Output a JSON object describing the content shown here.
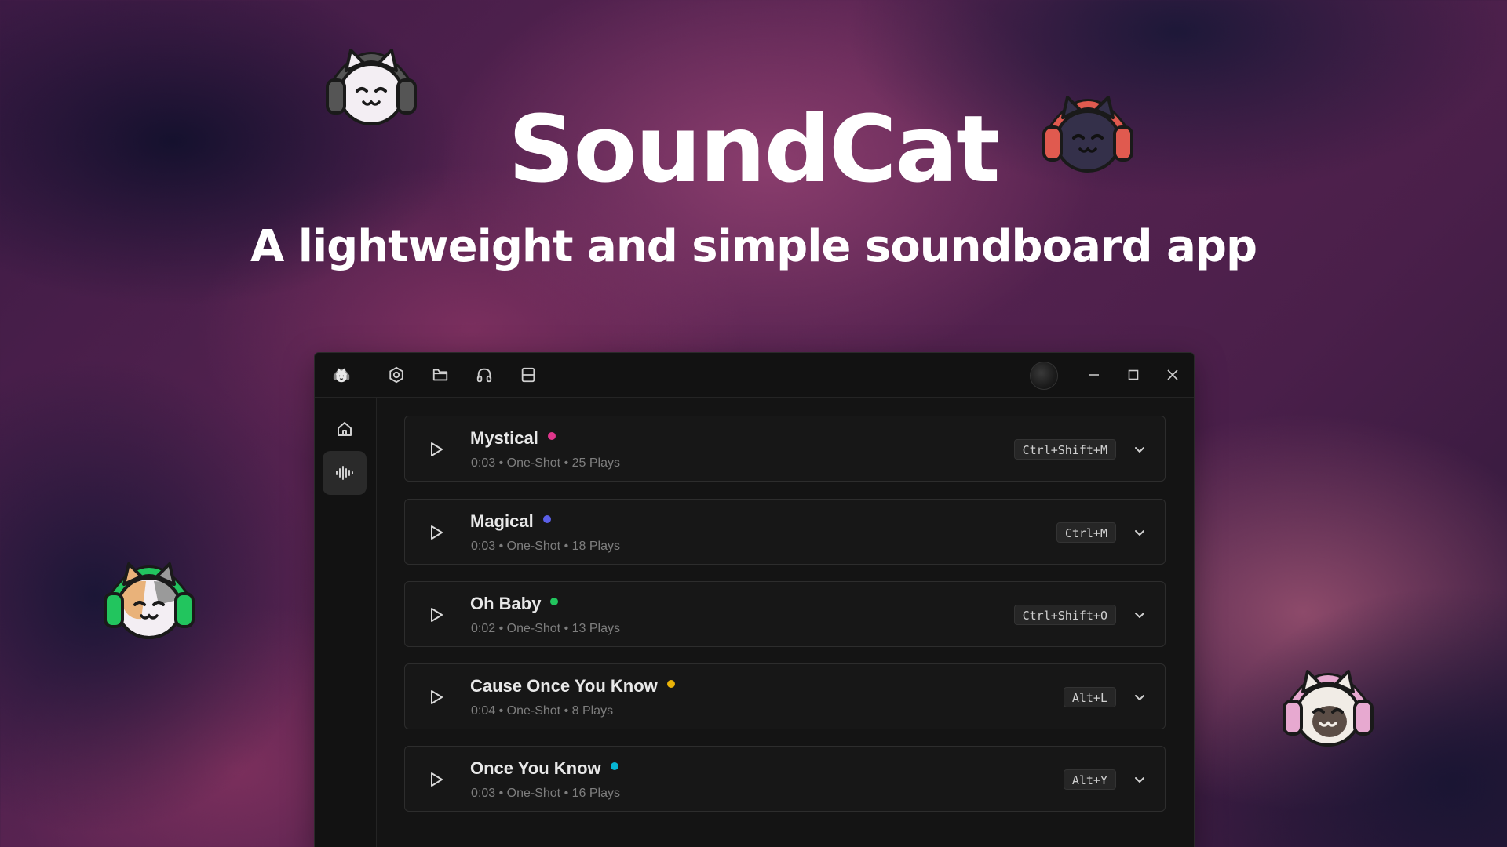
{
  "hero": {
    "title": "SoundCat",
    "subtitle": "A lightweight and simple soundboard app"
  },
  "titlebar": {
    "icons": [
      "cat-logo-icon",
      "settings-icon",
      "folder-icon",
      "headphones-icon",
      "layout-icon"
    ],
    "window_controls": [
      "minimize-icon",
      "maximize-icon",
      "close-icon"
    ]
  },
  "sidebar": {
    "items": [
      {
        "icon": "home-icon",
        "active": false
      },
      {
        "icon": "waveform-icon",
        "active": true
      }
    ]
  },
  "sounds": [
    {
      "name": "Mystical",
      "dot_color": "#e0368c",
      "meta": "0:03 • One-Shot • 25 Plays",
      "hotkey": "Ctrl+Shift+M"
    },
    {
      "name": "Magical",
      "dot_color": "#5b5fe8",
      "meta": "0:03 • One-Shot • 18 Plays",
      "hotkey": "Ctrl+M"
    },
    {
      "name": "Oh Baby",
      "dot_color": "#22c55e",
      "meta": "0:02 • One-Shot • 13 Plays",
      "hotkey": "Ctrl+Shift+O"
    },
    {
      "name": "Cause Once You Know",
      "dot_color": "#eab308",
      "meta": "0:04 • One-Shot • 8 Plays",
      "hotkey": "Alt+L"
    },
    {
      "name": "Once You Know",
      "dot_color": "#06b6d4",
      "meta": "0:03 • One-Shot • 16 Plays",
      "hotkey": "Alt+Y"
    }
  ],
  "mascots": [
    {
      "name": "white-cat-mascot",
      "headphone_color": "#555555"
    },
    {
      "name": "dark-cat-mascot",
      "headphone_color": "#e05a4f"
    },
    {
      "name": "calico-cat-mascot",
      "headphone_color": "#22c55e"
    },
    {
      "name": "siamese-cat-mascot",
      "headphone_color": "#e7a9d0"
    }
  ]
}
